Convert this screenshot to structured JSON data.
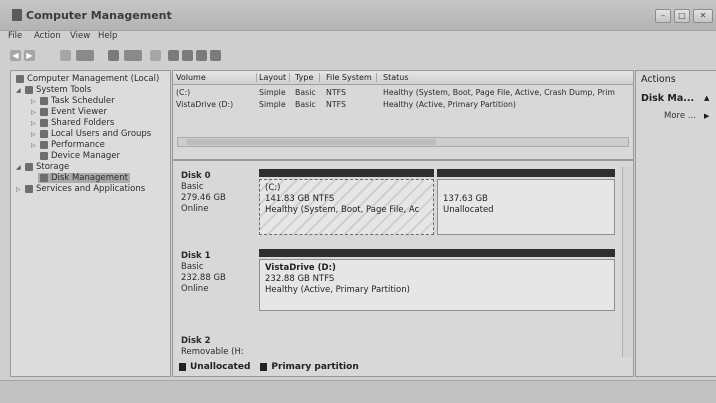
{
  "window": {
    "title": "Computer Management"
  },
  "menu": [
    "File",
    "Action",
    "View",
    "Help"
  ],
  "tree": {
    "root": "Computer Management (Local)",
    "items": [
      {
        "label": "System Tools"
      },
      {
        "label": "Task Scheduler"
      },
      {
        "label": "Event Viewer"
      },
      {
        "label": "Shared Folders"
      },
      {
        "label": "Local Users and Groups"
      },
      {
        "label": "Performance"
      },
      {
        "label": "Device Manager"
      },
      {
        "label": "Storage"
      },
      {
        "label": "Disk Management"
      },
      {
        "label": "Services and Applications"
      }
    ]
  },
  "volumes": {
    "headers": [
      "Volume",
      "Layout",
      "Type",
      "File System",
      "Status"
    ],
    "rows": [
      [
        "(C:)",
        "Simple",
        "Basic",
        "NTFS",
        "Healthy (System, Boot, Page File, Active, Crash Dump, Prim"
      ],
      [
        "VistaDrive (D:)",
        "Simple",
        "Basic",
        "NTFS",
        "Healthy (Active, Primary Partition)"
      ]
    ]
  },
  "disks": [
    {
      "name": "Disk 0",
      "type": "Basic",
      "size": "279.46 GB",
      "status": "Online",
      "partitions": [
        {
          "title": "(C:)",
          "size": "141.83 GB NTFS",
          "status": "Healthy (System, Boot, Page File, Ac"
        },
        {
          "title": "",
          "size": "137.63 GB",
          "status": "Unallocated"
        }
      ]
    },
    {
      "name": "Disk 1",
      "type": "Basic",
      "size": "232.88 GB",
      "status": "Online",
      "partitions": [
        {
          "title": "VistaDrive (D:)",
          "size": "232.88 GB NTFS",
          "status": "Healthy (Active, Primary Partition)"
        }
      ]
    },
    {
      "name": "Disk 2",
      "type": "Removable (H:",
      "size": "",
      "status": "",
      "partitions": []
    }
  ],
  "legend": [
    "Unallocated",
    "Primary partition"
  ],
  "actions": {
    "header": "Actions",
    "section": "Disk Ma...",
    "more": "More ..."
  },
  "colors": {
    "background": "#cfcfcf",
    "partition_bar": "#2f2f2f"
  }
}
